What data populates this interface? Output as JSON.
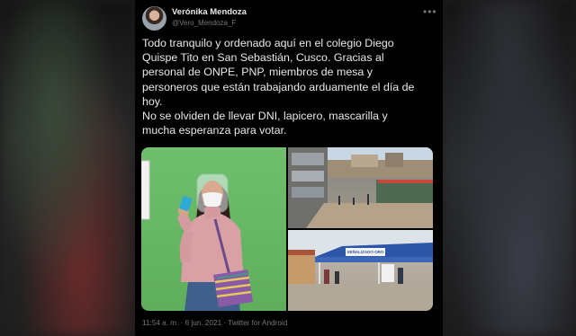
{
  "author": {
    "name": "Verónika Mendoza",
    "handle": "@Vero_Mendoza_F"
  },
  "tweet": {
    "lines": [
      "Todo tranquilo y ordenado aquí en el colegio Diego",
      "Quispe Tito en San Sebastián, Cusco. Gracias al",
      "personal de ONPE, PNP, miembros de mesa y",
      "personeros que están trabajando arduamente el día de",
      "hoy.",
      "No se olviden de llevar DNI, lapicero, mascarilla y",
      "mucha esperanza para votar."
    ],
    "timestamp": "11:54 a. m. · 6 jun. 2021 · Twitter for Android"
  },
  "photos": {
    "banner_text": "SEÑALIZADO ORO"
  },
  "icons": {
    "more": "more-horizontal-icon"
  }
}
